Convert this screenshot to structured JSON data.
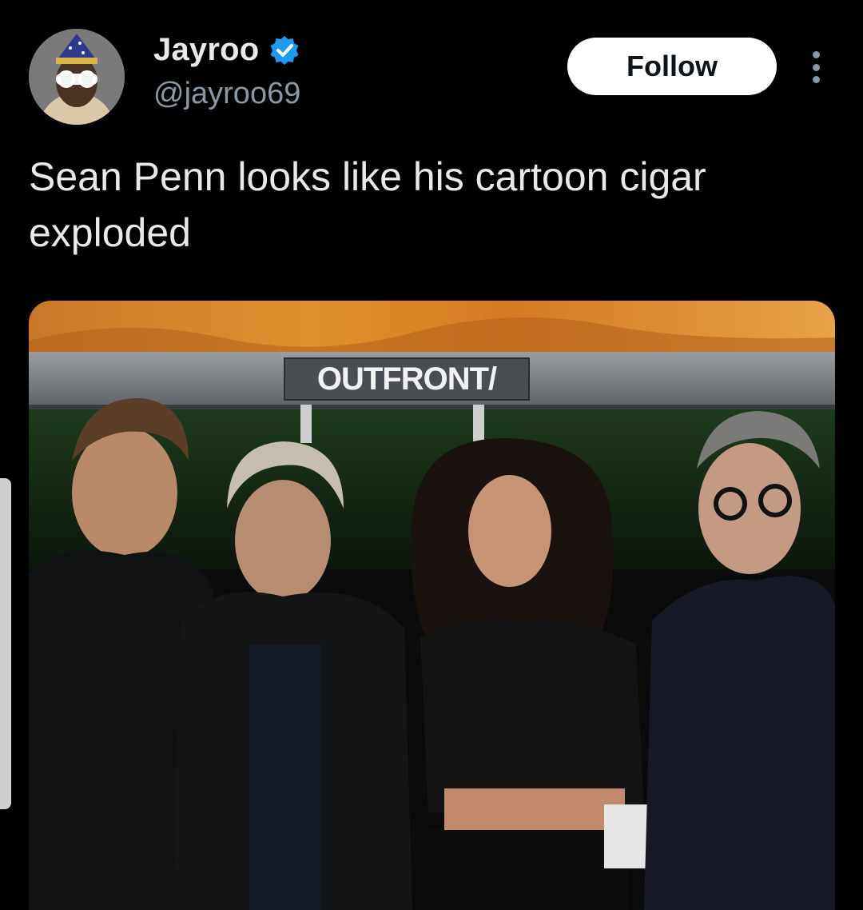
{
  "author": {
    "display_name": "Jayroo",
    "handle": "@jayroo69",
    "verified": true,
    "avatar_icon": "profile-avatar-icon",
    "verified_icon": "verified-badge-icon"
  },
  "actions": {
    "follow_label": "Follow",
    "more_icon": "more-options-icon"
  },
  "tweet": {
    "text": "Sean Penn looks like his cartoon cigar exploded"
  },
  "media": {
    "sign_text": "OUTFRONT/"
  },
  "colors": {
    "background": "#000000",
    "text_primary": "#e7e9ea",
    "text_secondary": "#8b98a5",
    "verified_blue": "#1d9bf0",
    "follow_bg": "#ffffff"
  }
}
